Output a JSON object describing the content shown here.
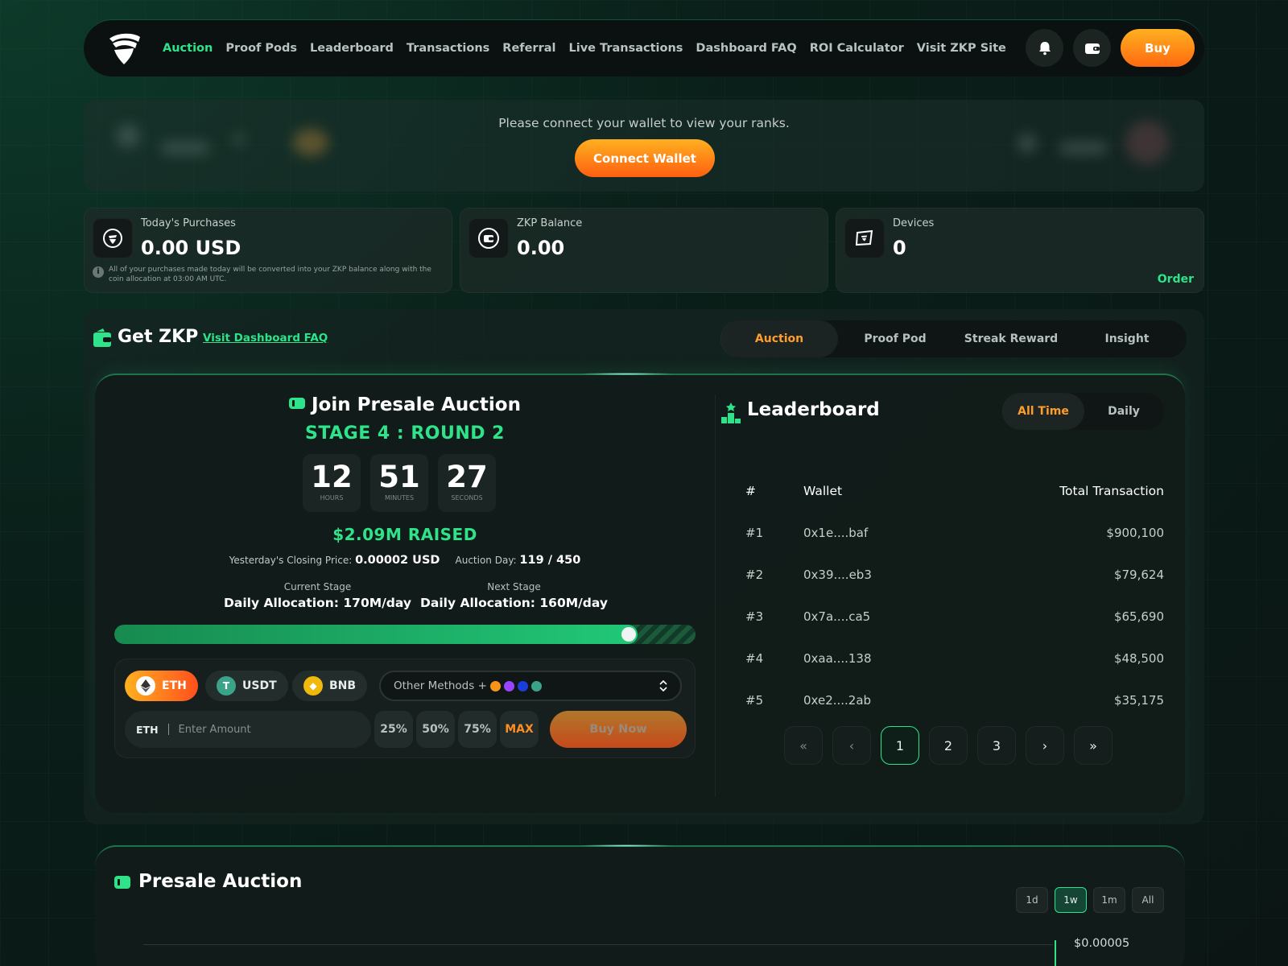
{
  "nav": {
    "links": [
      "Auction",
      "Proof Pods",
      "Leaderboard",
      "Transactions",
      "Referral",
      "Live Transactions",
      "Dashboard FAQ",
      "ROI Calculator",
      "Visit ZKP Site"
    ],
    "active": "Auction",
    "buy_label": "Buy"
  },
  "rank_banner": {
    "message": "Please connect your wallet to view your ranks.",
    "connect_label": "Connect Wallet"
  },
  "stats": {
    "purchases": {
      "label": "Today's Purchases",
      "value": "0.00 USD",
      "note": "All of your purchases made today will be converted into your ZKP balance along with the coin allocation at 03:00 AM UTC."
    },
    "balance": {
      "label": "ZKP Balance",
      "value": "0.00"
    },
    "devices": {
      "label": "Devices",
      "value": "0",
      "order_label": "Order"
    }
  },
  "get_zkp": {
    "title": "Get ZKP",
    "faq_link": "Visit Dashboard FAQ",
    "tabs": [
      "Auction",
      "Proof Pod",
      "Streak Reward",
      "Insight"
    ],
    "active_tab": "Auction"
  },
  "auction": {
    "title": "Join Presale Auction",
    "stage": "STAGE 4 : ROUND 2",
    "timer": {
      "hours": "12",
      "hours_label": "HOURS",
      "minutes": "51",
      "minutes_label": "MINUTES",
      "seconds": "27",
      "seconds_label": "SECONDS"
    },
    "raised": "$2.09M RAISED",
    "closing_price_label": "Yesterday's Closing Price:",
    "closing_price": "0.00002 USD",
    "auction_day_label": "Auction Day:",
    "auction_day": "119 / 450",
    "current_stage_label": "Current Stage",
    "current_stage_value": "Daily Allocation: 170M/day",
    "next_stage_label": "Next Stage",
    "next_stage_value": "Daily Allocation: 160M/day",
    "progress": 0.9,
    "coins": [
      "ETH",
      "USDT",
      "BNB"
    ],
    "active_coin": "ETH",
    "other_methods": "Other Methods +",
    "amount_currency": "ETH",
    "amount_placeholder": "Enter Amount",
    "percents": [
      "25%",
      "50%",
      "75%",
      "MAX"
    ],
    "buy_now": "Buy Now"
  },
  "leaderboard": {
    "title": "Leaderboard",
    "toggle": [
      "All Time",
      "Daily"
    ],
    "active_toggle": "All Time",
    "headers": [
      "#",
      "Wallet",
      "Total Transaction"
    ],
    "rows": [
      [
        "#1",
        "0x1e....baf",
        "$900,100"
      ],
      [
        "#2",
        "0x39....eb3",
        "$79,624"
      ],
      [
        "#3",
        "0x7a....ca5",
        "$65,690"
      ],
      [
        "#4",
        "0xaa....138",
        "$48,500"
      ],
      [
        "#5",
        "0xe2....2ab",
        "$35,175"
      ]
    ],
    "pager": [
      "«",
      "‹",
      "1",
      "2",
      "3",
      "›",
      "»"
    ],
    "active_page": "1"
  },
  "presale": {
    "title": "Presale Auction",
    "ranges": [
      "1d",
      "1w",
      "1m",
      "All"
    ],
    "active_range": "1w",
    "price_label": "$0.00005"
  },
  "colors": {
    "accent_green": "#2ee38a",
    "accent_orange": "#ff9d2a",
    "background": "#0b1614"
  }
}
